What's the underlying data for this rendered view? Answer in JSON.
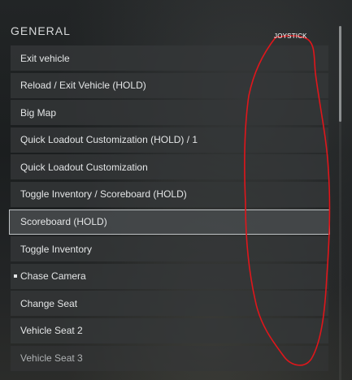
{
  "section": {
    "title": "GENERAL"
  },
  "items": [
    {
      "label": "Exit vehicle"
    },
    {
      "label": "Reload / Exit Vehicle (HOLD)"
    },
    {
      "label": "Big Map"
    },
    {
      "label": "Quick Loadout Customization (HOLD) / 1"
    },
    {
      "label": "Quick Loadout Customization"
    },
    {
      "label": "Toggle Inventory / Scoreboard (HOLD)"
    },
    {
      "label": "Scoreboard (HOLD)",
      "selected": true
    },
    {
      "label": "Toggle Inventory"
    },
    {
      "label": "Chase Camera",
      "bullet": true
    },
    {
      "label": "Change Seat"
    },
    {
      "label": "Vehicle Seat 2"
    },
    {
      "label": "Vehicle Seat 3"
    }
  ],
  "annotation": {
    "label": "JOYSTICK",
    "color": "#e0161b"
  }
}
